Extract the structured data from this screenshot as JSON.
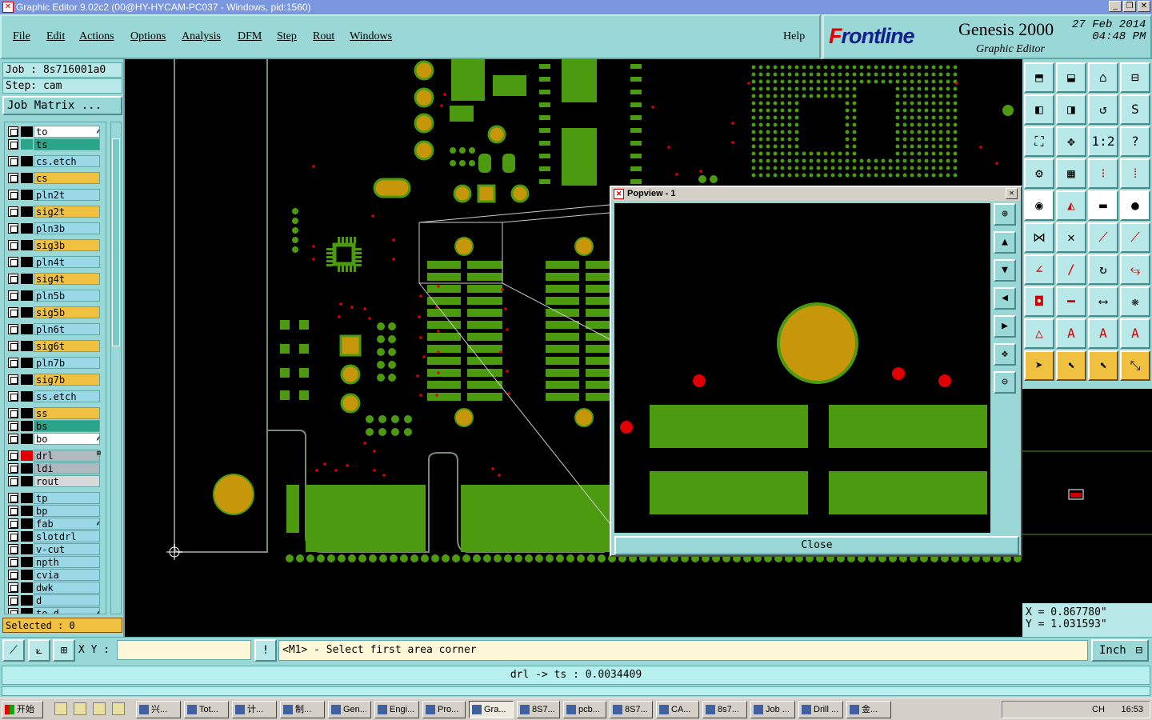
{
  "window": {
    "title": "Graphic Editor 9.02c2 (00@HY-HYCAM-PC037 - Windows, pid:1560)"
  },
  "menu": {
    "items": [
      "File",
      "Edit",
      "Actions",
      "Options",
      "Analysis",
      "DFM",
      "Step",
      "Rout",
      "Windows"
    ],
    "help": "Help"
  },
  "brand": {
    "logo_main": "rontline",
    "logo_f": "F",
    "product": "Genesis 2000",
    "subtitle": "Graphic Editor",
    "date": "27 Feb 2014",
    "time": "04:48 PM"
  },
  "job": {
    "job": "Job : 8s716001a0",
    "step": "Step: cam",
    "matrix_button": "Job Matrix ..."
  },
  "layers": [
    {
      "name": "to",
      "color": "#ffffff",
      "swatch": "#000000",
      "tick": "⸙"
    },
    {
      "name": "ts",
      "color": "#2aa58a",
      "swatch": "#2aa58a",
      "tick": ""
    },
    {
      "name": "cs.etch",
      "color": "#9ad8e8",
      "swatch": "#000000",
      "tick": ""
    },
    {
      "name": "cs",
      "color": "#f0c040",
      "swatch": "#000000",
      "tick": ""
    },
    {
      "name": "pln2t",
      "color": "#9ad8e8",
      "swatch": "#000000",
      "tick": ""
    },
    {
      "name": "sig2t",
      "color": "#f0c040",
      "swatch": "#000000",
      "tick": ""
    },
    {
      "name": "pln3b",
      "color": "#9ad8e8",
      "swatch": "#000000",
      "tick": ""
    },
    {
      "name": "sig3b",
      "color": "#f0c040",
      "swatch": "#000000",
      "tick": ""
    },
    {
      "name": "pln4t",
      "color": "#9ad8e8",
      "swatch": "#000000",
      "tick": ""
    },
    {
      "name": "sig4t",
      "color": "#f0c040",
      "swatch": "#000000",
      "tick": ""
    },
    {
      "name": "pln5b",
      "color": "#9ad8e8",
      "swatch": "#000000",
      "tick": ""
    },
    {
      "name": "sig5b",
      "color": "#f0c040",
      "swatch": "#000000",
      "tick": ""
    },
    {
      "name": "pln6t",
      "color": "#9ad8e8",
      "swatch": "#000000",
      "tick": ""
    },
    {
      "name": "sig6t",
      "color": "#f0c040",
      "swatch": "#000000",
      "tick": ""
    },
    {
      "name": "pln7b",
      "color": "#9ad8e8",
      "swatch": "#000000",
      "tick": ""
    },
    {
      "name": "sig7b",
      "color": "#f0c040",
      "swatch": "#000000",
      "tick": ""
    },
    {
      "name": "ss.etch",
      "color": "#9ad8e8",
      "swatch": "#000000",
      "tick": ""
    },
    {
      "name": "ss",
      "color": "#f0c040",
      "swatch": "#000000",
      "tick": ""
    },
    {
      "name": "bs",
      "color": "#2aa58a",
      "swatch": "#000000",
      "tick": ""
    },
    {
      "name": "bo",
      "color": "#ffffff",
      "swatch": "#000000",
      "tick": "⸙"
    },
    {
      "name": "drl",
      "color": "#b0b8c0",
      "swatch": "#e00000",
      "tick": "⊞"
    },
    {
      "name": "ldi",
      "color": "#b0b8c0",
      "swatch": "#000000",
      "tick": ""
    },
    {
      "name": "rout",
      "color": "#d8d8d8",
      "swatch": "#000000",
      "tick": ""
    },
    {
      "name": "tp",
      "color": "#9ad8e8",
      "swatch": "#000000",
      "tick": ""
    },
    {
      "name": "bp",
      "color": "#9ad8e8",
      "swatch": "#000000",
      "tick": ""
    },
    {
      "name": "fab",
      "color": "#9ad8e8",
      "swatch": "#000000",
      "tick": "⸙"
    },
    {
      "name": "slotdrl",
      "color": "#9ad8e8",
      "swatch": "#000000",
      "tick": ""
    },
    {
      "name": "v-cut",
      "color": "#9ad8e8",
      "swatch": "#000000",
      "tick": ""
    },
    {
      "name": "npth",
      "color": "#9ad8e8",
      "swatch": "#000000",
      "tick": ""
    },
    {
      "name": "cvia",
      "color": "#9ad8e8",
      "swatch": "#000000",
      "tick": ""
    },
    {
      "name": "dwk",
      "color": "#9ad8e8",
      "swatch": "#000000",
      "tick": ""
    },
    {
      "name": "d",
      "color": "#9ad8e8",
      "swatch": "#000000",
      "tick": ""
    },
    {
      "name": "to_d",
      "color": "#9ad8e8",
      "swatch": "#000000",
      "tick": "⸙"
    }
  ],
  "selected": "Selected : 0",
  "popview": {
    "title": "Popview - 1",
    "close_button": "Close"
  },
  "coords": {
    "x": "X = 0.867780\"",
    "y": "Y = 1.031593\""
  },
  "bottom": {
    "xy_label": "X Y :",
    "xy_value": "",
    "prompt": "<M1> - Select first area corner",
    "units": "Inch"
  },
  "status": "drl -> ts : 0.0034409",
  "taskbar": {
    "start": "开始",
    "tasks": [
      "兴...",
      "Tot...",
      "计...",
      "制...",
      "Gen...",
      "Engi...",
      "Pro...",
      "Gra...",
      "8S7...",
      "pcb...",
      "8S7...",
      "CA...",
      "8s7...",
      "Job ...",
      "Drill ...",
      "金..."
    ],
    "clock": "16:53",
    "lang": "CH"
  },
  "colors": {
    "panel": "#9ad8d8",
    "pad_green": "#4c9a10",
    "pad_gold": "#c8960a",
    "drill_red": "#e00000"
  }
}
